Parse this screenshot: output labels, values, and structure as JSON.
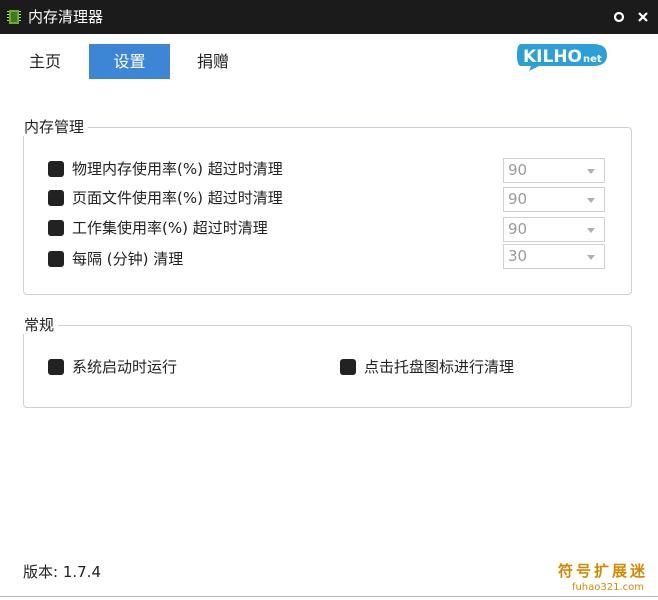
{
  "window": {
    "title": "内存清理器",
    "icon": "memory-chip-icon",
    "buttons": [
      "settings-icon",
      "close-icon"
    ]
  },
  "nav": {
    "tabs": [
      {
        "label": "主页",
        "active": false
      },
      {
        "label": "设置",
        "active": true
      },
      {
        "label": "捐赠",
        "active": false
      }
    ]
  },
  "logo": {
    "text": "KILHO",
    "suffix": "net"
  },
  "memory_group": {
    "title": "内存管理",
    "rows": [
      {
        "label": "物理内存使用率(%) 超过时清理",
        "value": "90",
        "checked": true
      },
      {
        "label": "页面文件使用率(%) 超过时清理",
        "value": "90",
        "checked": true
      },
      {
        "label": "工作集使用率(%) 超过时清理",
        "value": "90",
        "checked": true
      },
      {
        "label": "每隔 (分钟) 清理",
        "value": "30",
        "checked": true
      }
    ]
  },
  "general_group": {
    "title": "常规",
    "options": [
      {
        "label": "系统启动时运行",
        "checked": true
      },
      {
        "label": "点击托盘图标进行清理",
        "checked": true
      }
    ]
  },
  "footer": {
    "version": "版本: 1.7.4",
    "watermark": "符号扩展迷",
    "watermark_sub": "fuhao321.com"
  },
  "colors": {
    "titlebar": "#1b1b1b",
    "active_tab": "#3d86d6",
    "logo_blue": "#2a9fd8",
    "watermark": "#d18a00",
    "checkbox": "#222222"
  }
}
